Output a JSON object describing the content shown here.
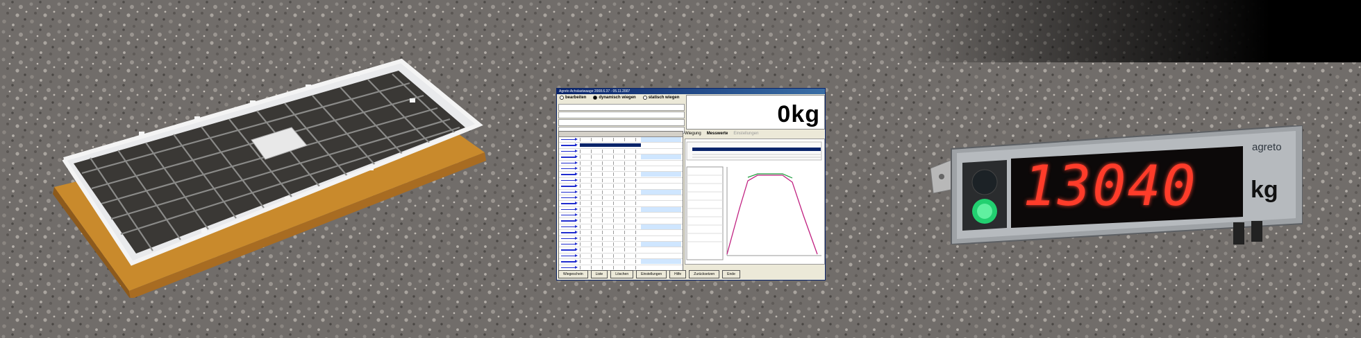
{
  "software_window": {
    "title": "Agreto Achslastwaage 2008.6.37 - 05.11.2007",
    "modes": [
      {
        "label": "bearbeiten",
        "selected": false
      },
      {
        "label": "dynamisch wiegen",
        "selected": true
      },
      {
        "label": "statisch wiegen",
        "selected": false
      }
    ],
    "weight_value": "0",
    "weight_unit": "kg",
    "tabs": [
      {
        "label": "Wiegung",
        "active": false
      },
      {
        "label": "Messwerte",
        "active": true
      },
      {
        "label": "Einstellungen",
        "active": false
      }
    ],
    "buttons": [
      "Wiegeschein",
      "Liste",
      "Löschen",
      "Einstellungen",
      "Hilfe",
      "Zurücksetzen",
      "Ende"
    ]
  },
  "display_unit": {
    "brand": "agreto",
    "reading": "13040",
    "unit": "kg",
    "digit_color": "#ff3c2a",
    "status_light": "green"
  },
  "colors": {
    "gravel": "#6f6c69",
    "scale_frame_wood": "#d9a43a",
    "chart_line": "#c02080"
  }
}
